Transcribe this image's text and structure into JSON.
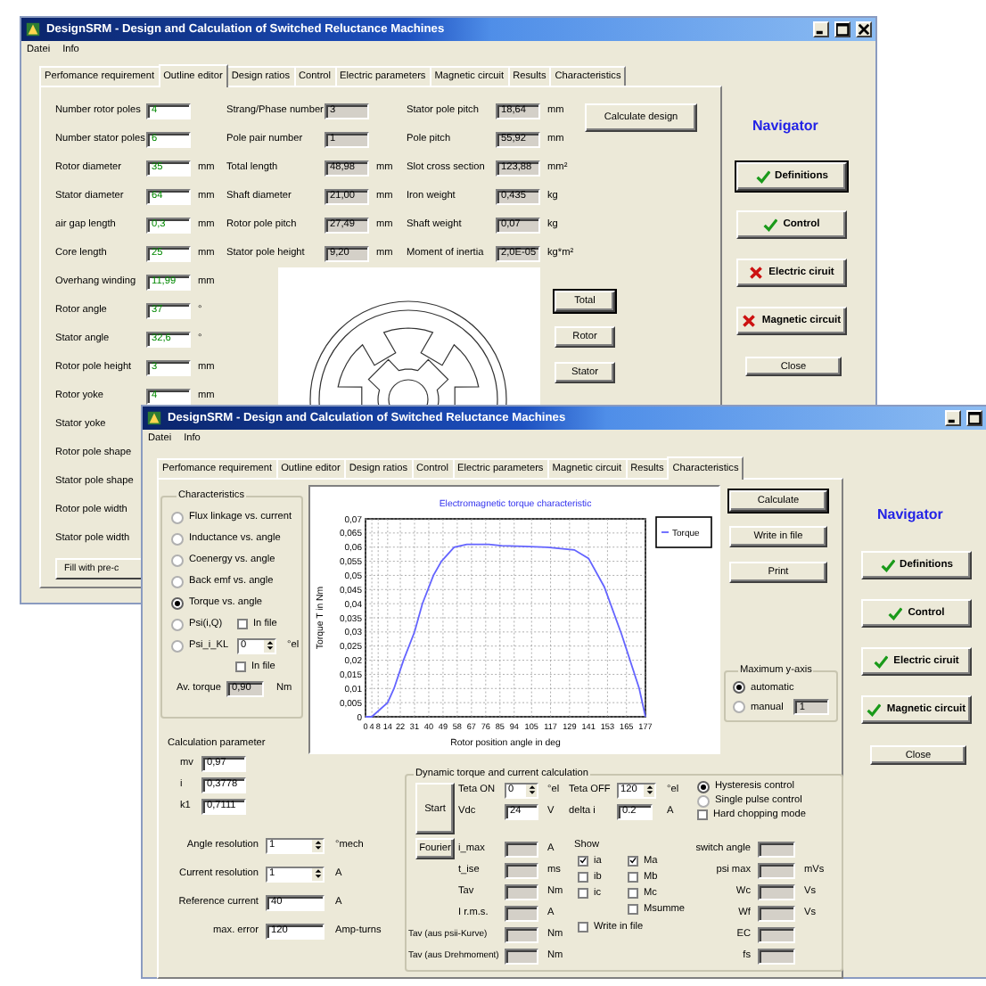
{
  "back_window": {
    "title": "DesignSRM  - Design and Calculation of Switched Reluctance Machines",
    "controls": [
      {
        "kind": "minimize"
      },
      {
        "kind": "maximize"
      },
      {
        "kind": "close"
      }
    ],
    "menu": [
      "Datei",
      "Info"
    ],
    "tabs": [
      {
        "label": "Perfomance requirement",
        "selected": false
      },
      {
        "label": "Outline editor",
        "selected": true
      },
      {
        "label": "Design ratios",
        "selected": false
      },
      {
        "label": "Control",
        "selected": false
      },
      {
        "label": "Electric parameters",
        "selected": false
      },
      {
        "label": "Magnetic circuit",
        "selected": false
      },
      {
        "label": "Results",
        "selected": false
      },
      {
        "label": "Characteristics",
        "selected": false
      }
    ],
    "inputs": [
      {
        "label": "Number rotor poles",
        "value": "4"
      },
      {
        "label": "Number stator poles",
        "value": "6"
      },
      {
        "label": "Rotor diameter",
        "value": "35",
        "unit": "mm"
      },
      {
        "label": "Stator diameter",
        "value": "64",
        "unit": "mm"
      },
      {
        "label": "air gap length",
        "value": "0,3",
        "unit": "mm"
      },
      {
        "label": "Core length",
        "value": "25",
        "unit": "mm"
      },
      {
        "label": "Overhang winding",
        "value": "11,99",
        "unit": "mm"
      },
      {
        "label": "Rotor angle",
        "value": "37",
        "unit": "°"
      },
      {
        "label": "Stator angle",
        "value": "32,6",
        "unit": "°"
      },
      {
        "label": "Rotor pole height",
        "value": "3",
        "unit": "mm"
      },
      {
        "label": "Rotor yoke",
        "value": "4",
        "unit": "mm"
      },
      {
        "label": "Stator yoke"
      },
      {
        "label": "Rotor pole shape"
      },
      {
        "label": "Stator pole shape"
      },
      {
        "label": "Rotor pole width"
      },
      {
        "label": "Stator pole width"
      }
    ],
    "derived": [
      {
        "label": "Strang/Phase number",
        "value": "3"
      },
      {
        "label": "Pole pair number",
        "value": "1"
      },
      {
        "label": "Total length",
        "value": "48,98",
        "unit": "mm"
      },
      {
        "label": "Shaft diameter",
        "value": "21,00",
        "unit": "mm"
      },
      {
        "label": "Rotor pole pitch",
        "value": "27,49",
        "unit": "mm"
      },
      {
        "label": "Stator pole height",
        "value": "9,20",
        "unit": "mm"
      }
    ],
    "results": [
      {
        "label": "Stator pole pitch",
        "value": "18,64",
        "unit": "mm"
      },
      {
        "label": "Pole pitch",
        "value": "55,92",
        "unit": "mm"
      },
      {
        "label": "Slot cross section",
        "value": "123,88",
        "unit": "mm²"
      },
      {
        "label": "Iron weight",
        "value": "0,435",
        "unit": "kg"
      },
      {
        "label": "Shaft weight",
        "value": "0,07",
        "unit": "kg"
      },
      {
        "label": "Moment of inertia",
        "value": "2,0E-05",
        "unit": "kg*m²"
      }
    ],
    "calculate_button": "Calculate design",
    "view_buttons": [
      {
        "label": "Total",
        "focused": true
      },
      {
        "label": "Rotor",
        "focused": false
      },
      {
        "label": "Stator",
        "focused": false
      }
    ],
    "fill_button": "Fill with pre-c",
    "navigator": {
      "title": "Navigator",
      "items": [
        {
          "label": "Definitions",
          "done": true,
          "focused": true
        },
        {
          "label": "Control",
          "done": true,
          "focused": false
        },
        {
          "label": "Electric ciruit",
          "done": false,
          "focused": false
        },
        {
          "label": "Magnetic circuit",
          "done": false,
          "focused": false
        }
      ],
      "close": "Close"
    }
  },
  "front_window": {
    "title": "DesignSRM  - Design and Calculation of Switched Reluctance Machines",
    "controls": [
      {
        "kind": "minimize"
      },
      {
        "kind": "maximize"
      }
    ],
    "menu": [
      "Datei",
      "Info"
    ],
    "tabs": [
      {
        "label": "Perfomance requirement",
        "selected": false
      },
      {
        "label": "Outline editor",
        "selected": false
      },
      {
        "label": "Design ratios",
        "selected": false
      },
      {
        "label": "Control",
        "selected": false
      },
      {
        "label": "Electric parameters",
        "selected": false
      },
      {
        "label": "Magnetic circuit",
        "selected": false
      },
      {
        "label": "Results",
        "selected": false
      },
      {
        "label": "Characteristics",
        "selected": true
      }
    ],
    "characteristics": {
      "title": "Characteristics",
      "options": [
        {
          "label": "Flux linkage vs. current",
          "selected": false
        },
        {
          "label": "Inductance vs. angle",
          "selected": false
        },
        {
          "label": "Coenergy vs. angle",
          "selected": false
        },
        {
          "label": "Back emf vs. angle",
          "selected": false
        },
        {
          "label": "Torque vs. angle",
          "selected": true
        },
        {
          "label": "Psi(i,Q)",
          "selected": false,
          "in_file": {
            "label": "In file",
            "checked": false
          }
        },
        {
          "label": "Psi_i_KL",
          "selected": false,
          "spin": {
            "value": "0",
            "unit": "°el"
          }
        }
      ],
      "in_file": {
        "label": "In file",
        "checked": false
      },
      "av_torque": {
        "label": "Av. torque",
        "value": "0,90",
        "unit": "Nm"
      }
    },
    "chart": {
      "chart_data": {
        "type": "line",
        "title": "Electromagnetic torque characteristic",
        "xlabel": "Rotor position angle in deg",
        "ylabel": "Torque T in Nm",
        "grid": true,
        "x": [
          0,
          4,
          14,
          18,
          24,
          31,
          36,
          43,
          48,
          56,
          64,
          78,
          86,
          100,
          115,
          132,
          141,
          151,
          162,
          173,
          177
        ],
        "series": [
          {
            "name": "Torque",
            "color": "#6464ff",
            "values": [
              0,
              0,
              0.005,
              0.01,
              0.02,
              0.03,
              0.04,
              0.05,
              0.055,
              0.06,
              0.061,
              0.061,
              0.0605,
              0.0603,
              0.06,
              0.059,
              0.056,
              0.046,
              0.029,
              0.01,
              0
            ]
          }
        ],
        "xlim": [
          0,
          177
        ],
        "ylim": [
          0,
          0.07
        ],
        "xticks": [
          0,
          4,
          8,
          14,
          22,
          31,
          40,
          49,
          58,
          67,
          76,
          85,
          94,
          105,
          117,
          129,
          141,
          153,
          165,
          177
        ],
        "yticks": [
          {
            "value": 0,
            "label": "0"
          },
          {
            "value": 0.005,
            "label": "0,005"
          },
          {
            "value": 0.01,
            "label": "0,01"
          },
          {
            "value": 0.015,
            "label": "0,015"
          },
          {
            "value": 0.02,
            "label": "0,02"
          },
          {
            "value": 0.025,
            "label": "0,025"
          },
          {
            "value": 0.03,
            "label": "0,03"
          },
          {
            "value": 0.035,
            "label": "0,035"
          },
          {
            "value": 0.04,
            "label": "0,04"
          },
          {
            "value": 0.045,
            "label": "0,045"
          },
          {
            "value": 0.05,
            "label": "0,05"
          },
          {
            "value": 0.055,
            "label": "0,055"
          },
          {
            "value": 0.06,
            "label": "0,06"
          },
          {
            "value": 0.065,
            "label": "0,065"
          },
          {
            "value": 0.07,
            "label": "0,07"
          }
        ]
      }
    },
    "actions": [
      {
        "label": "Calculate",
        "focused": true
      },
      {
        "label": "Write in file",
        "focused": false
      },
      {
        "label": "Print",
        "focused": false
      }
    ],
    "max_y_axis": {
      "title": "Maximum y-axis",
      "options": [
        {
          "label": "automatic",
          "selected": true
        },
        {
          "label": "manual",
          "selected": false
        }
      ],
      "manual_value": "1"
    },
    "calc_params": {
      "title": "Calculation parameter",
      "params": [
        {
          "label": "mv",
          "value": "0,97"
        },
        {
          "label": "i",
          "value": "0,3778"
        },
        {
          "label": "k1",
          "value": "0,7111"
        }
      ],
      "settings": [
        {
          "label": "Angle resolution",
          "value": "1",
          "unit": "°mech",
          "kind": "spin"
        },
        {
          "label": "Current resolution",
          "value": "1",
          "unit": "A",
          "kind": "spin"
        },
        {
          "label": "Reference current",
          "value": "40",
          "unit": "A",
          "kind": "text"
        },
        {
          "label": "max. error",
          "value": "120",
          "unit": "Amp-turns",
          "kind": "text"
        }
      ]
    },
    "dynamic": {
      "title": "Dynamic torque and current calculation",
      "start": "Start",
      "fourier": "Fourier",
      "teta_on": {
        "label": "Teta ON",
        "value": "0",
        "unit": "°el"
      },
      "teta_off": {
        "label": "Teta OFF",
        "value": "120",
        "unit": "°el"
      },
      "vdc": {
        "label": "Vdc",
        "value": "24",
        "unit": "V"
      },
      "delta_i": {
        "label": "delta i",
        "value": "0.2",
        "unit": "A"
      },
      "modes": [
        {
          "label": "Hysteresis control",
          "selected": true
        },
        {
          "label": "Single pulse control",
          "selected": false
        }
      ],
      "hard_chopping": {
        "label": "Hard chopping mode",
        "checked": false
      },
      "outputs": [
        {
          "label": "i_max",
          "unit": "A"
        },
        {
          "label": "t_ise",
          "unit": "ms"
        },
        {
          "label": "Tav",
          "unit": "Nm"
        },
        {
          "label": "I r.m.s.",
          "unit": "A"
        }
      ],
      "show": {
        "title": "Show",
        "items": [
          {
            "label": "ia",
            "checked": true
          },
          {
            "label": "Ma",
            "checked": true
          },
          {
            "label": "ib",
            "checked": false
          },
          {
            "label": "Mb",
            "checked": false
          },
          {
            "label": "ic",
            "checked": false
          },
          {
            "label": "Mc",
            "checked": false
          },
          {
            "label": "Msumme",
            "checked": false
          }
        ]
      },
      "write_in_file": {
        "label": "Write in file",
        "checked": false
      },
      "tav": [
        {
          "label": "Tav (aus psii-Kurve)",
          "unit": "Nm"
        },
        {
          "label": "Tav (aus Drehmoment)",
          "unit": "Nm"
        }
      ],
      "extras": [
        {
          "label": "switch angle"
        },
        {
          "label": "psi max",
          "unit": "mVs"
        },
        {
          "label": "Wc",
          "unit": "Vs"
        },
        {
          "label": "Wf",
          "unit": "Vs"
        },
        {
          "label": "EC"
        },
        {
          "label": "fs"
        }
      ]
    },
    "navigator": {
      "title": "Navigator",
      "items": [
        {
          "label": "Definitions",
          "done": true,
          "focused": false
        },
        {
          "label": "Control",
          "done": true,
          "focused": false
        },
        {
          "label": "Electric ciruit",
          "done": true,
          "focused": false
        },
        {
          "label": "Magnetic circuit",
          "done": true,
          "focused": false
        }
      ],
      "close": "Close"
    }
  }
}
